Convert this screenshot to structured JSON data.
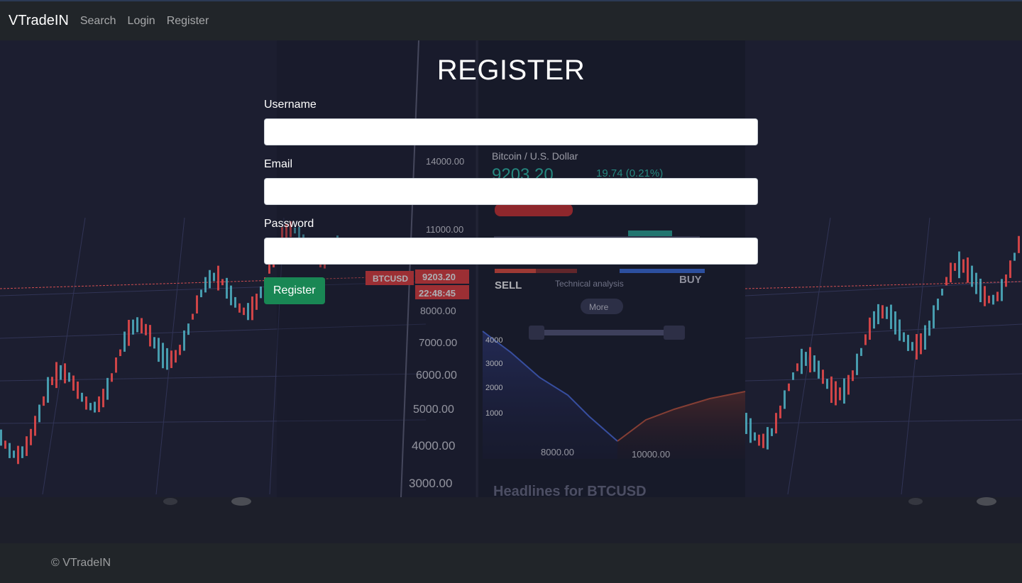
{
  "navbar": {
    "brand": "VTradeIN",
    "links": [
      "Search",
      "Login",
      "Register"
    ]
  },
  "background": {
    "ticker_symbol": "BTCUSD",
    "ticker_price": "9203.20",
    "ticker_time": "22:48:45",
    "pair_title": "Bitcoin / U.S. Dollar",
    "pair_price": "9203.20",
    "pair_change": "19.74 (0.21%)",
    "price_axis": [
      "14000.00",
      "11000.00",
      "8000.00",
      "7000.00",
      "6000.00",
      "5000.00",
      "4000.00",
      "3000.00"
    ],
    "sell_label": "SELL",
    "buy_label": "BUY",
    "analysis_label": "Technical analysis",
    "more_label": "More",
    "depth_axis": [
      "4000",
      "3000",
      "2000",
      "1000"
    ],
    "depth_x": [
      "8000.00",
      "10000.00"
    ],
    "headline": "Headlines for BTCUSD"
  },
  "form": {
    "title": "REGISTER",
    "username_label": "Username",
    "username_value": "",
    "email_label": "Email",
    "email_value": "",
    "password_label": "Password",
    "password_value": "",
    "submit_label": "Register"
  },
  "footer": {
    "copyright": "© VTradeIN"
  },
  "colors": {
    "navbar_bg": "#212529",
    "accent_green": "#198754",
    "candle_up": "#4fb3c4",
    "candle_down": "#ef4b4b"
  }
}
